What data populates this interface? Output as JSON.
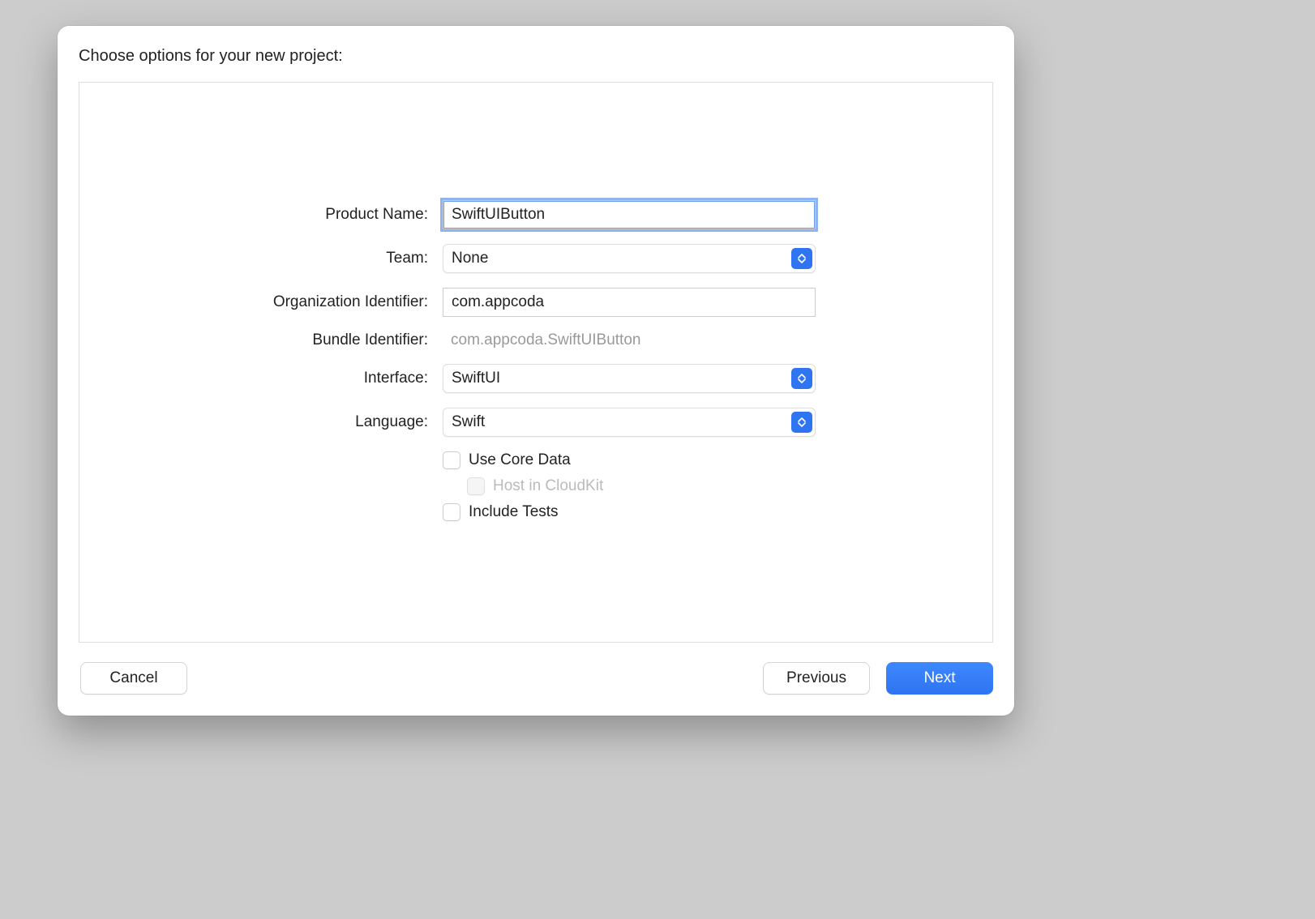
{
  "header": {
    "title": "Choose options for your new project:"
  },
  "form": {
    "product_name_label": "Product Name:",
    "product_name_value": "SwiftUIButton",
    "team_label": "Team:",
    "team_value": "None",
    "org_id_label": "Organization Identifier:",
    "org_id_value": "com.appcoda",
    "bundle_id_label": "Bundle Identifier:",
    "bundle_id_value": "com.appcoda.SwiftUIButton",
    "interface_label": "Interface:",
    "interface_value": "SwiftUI",
    "language_label": "Language:",
    "language_value": "Swift",
    "use_core_data_label": "Use Core Data",
    "host_cloudkit_label": "Host in CloudKit",
    "include_tests_label": "Include Tests"
  },
  "footer": {
    "cancel_label": "Cancel",
    "previous_label": "Previous",
    "next_label": "Next"
  }
}
